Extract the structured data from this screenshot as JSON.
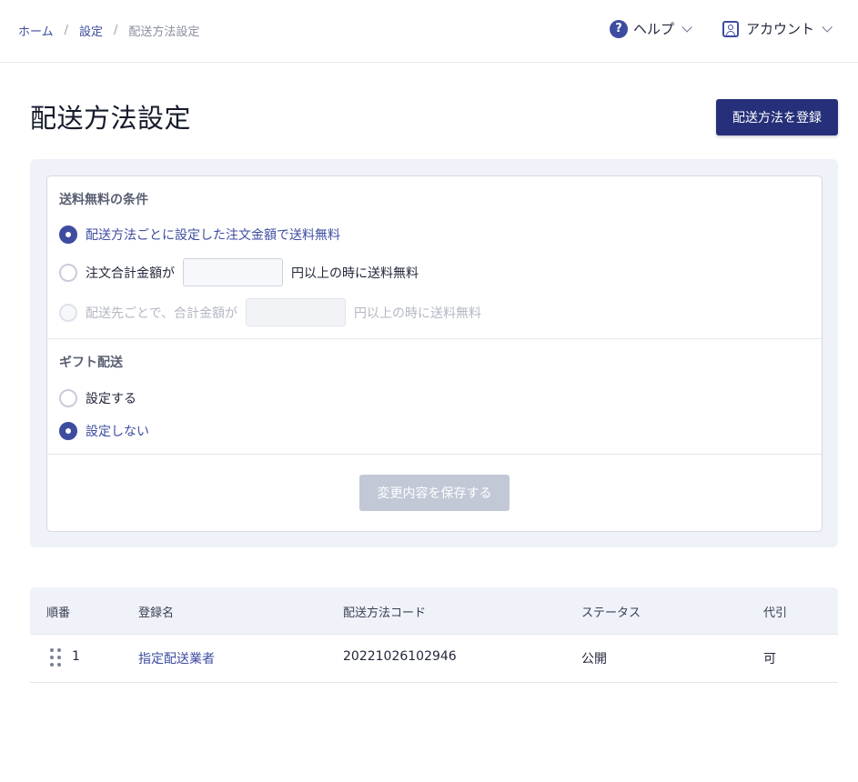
{
  "breadcrumb": {
    "home": "ホーム",
    "settings": "設定",
    "current": "配送方法設定",
    "separator": "/"
  },
  "topnav": {
    "help_label": "ヘルプ",
    "help_icon_glyph": "?",
    "account_label": "アカウント"
  },
  "page": {
    "title": "配送方法設定",
    "register_button": "配送方法を登録"
  },
  "free_shipping": {
    "section_title": "送料無料の条件",
    "option_per_method": "配送方法ごとに設定した注文金額で送料無料",
    "option_total_prefix": "注文合計金額が",
    "option_total_suffix": "円以上の時に送料無料",
    "option_total_value": "",
    "option_destination_prefix": "配送先ごとで、合計金額が",
    "option_destination_suffix": "円以上の時に送料無料",
    "option_destination_value": "",
    "selected": "per_method"
  },
  "gift": {
    "section_title": "ギフト配送",
    "option_enable": "設定する",
    "option_disable": "設定しない",
    "selected": "disable"
  },
  "save_button": "変更内容を保存する",
  "table": {
    "headers": {
      "order": "順番",
      "name": "登録名",
      "code": "配送方法コード",
      "status": "ステータス",
      "cod": "代引"
    },
    "rows": [
      {
        "order": "1",
        "name": "指定配送業者",
        "code": "20221026102946",
        "status": "公開",
        "cod": "可"
      }
    ]
  },
  "colors": {
    "accent": "#3e4ca0",
    "primary_button": "#26307a",
    "disabled_button": "#c2c8d6",
    "panel_background": "#f0f2f9"
  }
}
